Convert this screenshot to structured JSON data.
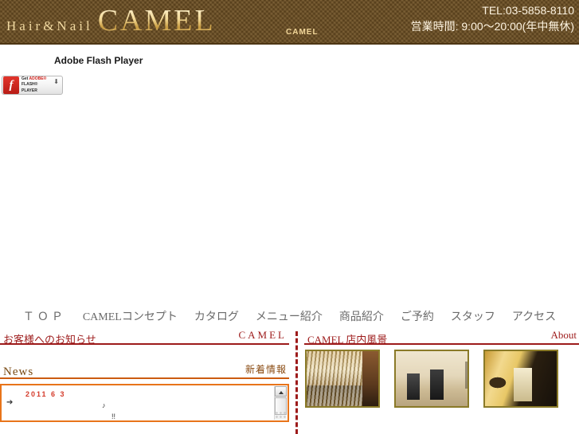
{
  "header": {
    "logo_sub": "Hair&Nail",
    "logo_main": "CAMEL",
    "mini_brand": "CAMEL",
    "tel": "TEL:03-5858-8110",
    "hours": "営業時間: 9:00～20:00(年中無休)",
    "bg_color": "#6d4f22",
    "logo_color": "#f0d8a0"
  },
  "flash": {
    "title": "Adobe Flash Player",
    "badge_get": "Get ",
    "badge_adobe": "ADOBE®",
    "badge_player": "FLASH® PLAYER",
    "badge_arrow": "⬇",
    "badge_logo_glyph": "f"
  },
  "nav": {
    "items": [
      {
        "label": "ＴＯＰ"
      },
      {
        "label": "CAMELコンセプト"
      },
      {
        "label": "カタログ"
      },
      {
        "label": "メニュー紹介"
      },
      {
        "label": "商品紹介"
      },
      {
        "label": "ご予約"
      },
      {
        "label": "スタッフ"
      },
      {
        "label": "アクセス"
      }
    ]
  },
  "left_column": {
    "section_title": "お客様へのお知らせ",
    "section_title_right": "CAMEL",
    "news_title": "News",
    "news_title_right": "新着情報",
    "news": {
      "arrow": "➔",
      "date": "2011 6 3",
      "line1": "♪",
      "line2": "!!"
    }
  },
  "right_column": {
    "section_title": "CAMEL 店内風景",
    "section_title_right": "About",
    "photos": [
      {
        "caption": "salon-interior-mirror-wall"
      },
      {
        "caption": "salon-interior-styling-stations"
      },
      {
        "caption": "salon-interior-shampoo-area"
      }
    ]
  },
  "colors": {
    "accent_red": "#9d1b1b",
    "accent_orange": "#e8741a",
    "news_date_red": "#d43a2a",
    "photo_border": "#8a7a28"
  }
}
